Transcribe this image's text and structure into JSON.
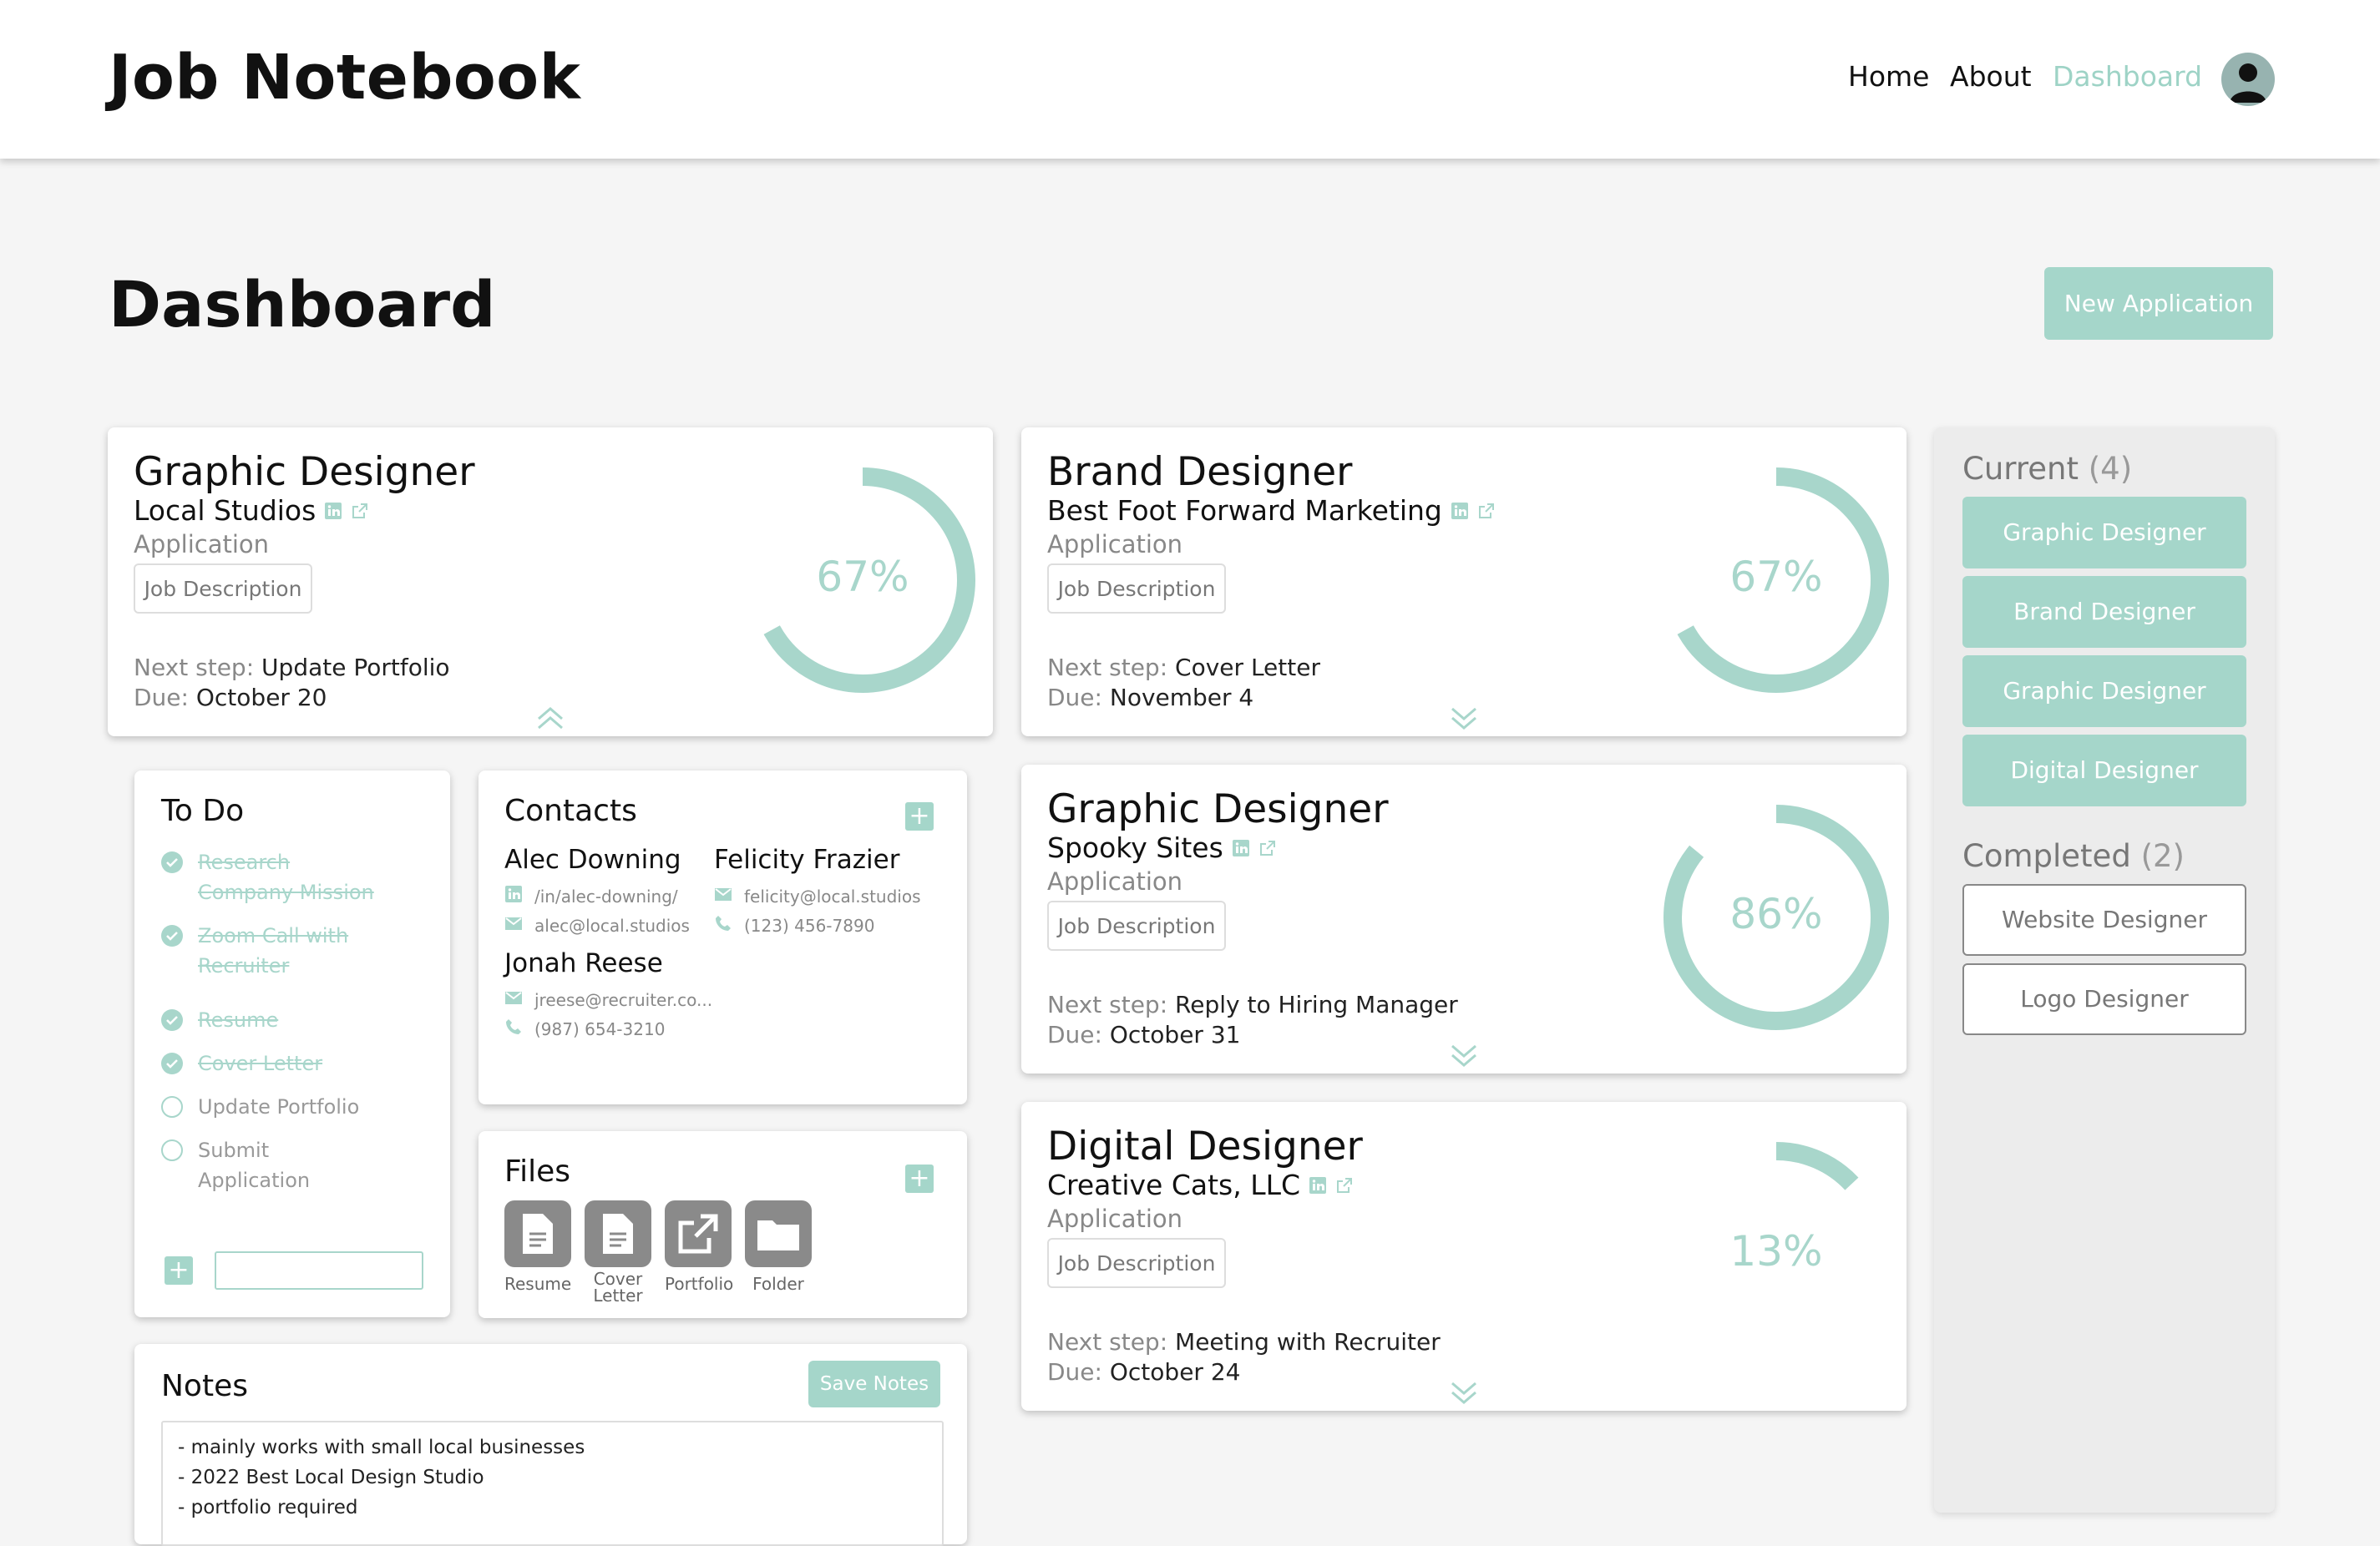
{
  "header": {
    "brand": "Job Notebook",
    "nav": {
      "home": "Home",
      "about": "About",
      "dashboard": "Dashboard"
    }
  },
  "page": {
    "title": "Dashboard",
    "new_application": "New Application"
  },
  "colors": {
    "accent": "#a5d6ca",
    "ring": "#a8d6cb"
  },
  "applications": [
    {
      "title": "Graphic Designer",
      "company": "Local Studios",
      "stage": "Application",
      "jd": "Job Description",
      "next_label": "Next step:",
      "next": "Update Portfolio",
      "due_label": "Due:",
      "due": "October 20",
      "progress_label": "67%",
      "progress": 0.67,
      "expanded": true
    },
    {
      "title": "Brand Designer",
      "company": "Best Foot Forward Marketing",
      "stage": "Application",
      "jd": "Job Description",
      "next_label": "Next step:",
      "next": "Cover Letter",
      "due_label": "Due:",
      "due": "November 4",
      "progress_label": "67%",
      "progress": 0.67,
      "expanded": false
    },
    {
      "title": "Graphic Designer",
      "company": "Spooky Sites",
      "stage": "Application",
      "jd": "Job Description",
      "next_label": "Next step:",
      "next": "Reply to Hiring Manager",
      "due_label": "Due:",
      "due": "October 31",
      "progress_label": "86%",
      "progress": 0.86,
      "expanded": false
    },
    {
      "title": "Digital Designer",
      "company": "Creative Cats, LLC",
      "stage": "Application",
      "jd": "Job Description",
      "next_label": "Next step:",
      "next": "Meeting with Recruiter",
      "due_label": "Due:",
      "due": "October 24",
      "progress_label": "13%",
      "progress": 0.13,
      "expanded": false
    }
  ],
  "todo": {
    "title": "To Do",
    "items": [
      {
        "text": "Research Company Mission",
        "done": true
      },
      {
        "text": "Zoom Call with Recruiter",
        "done": true
      },
      {
        "text": "Resume",
        "done": true
      },
      {
        "text": "Cover Letter",
        "done": true
      },
      {
        "text": "Update Portfolio",
        "done": false
      },
      {
        "text": "Submit Application",
        "done": false
      }
    ],
    "add_value": ""
  },
  "contacts": {
    "title": "Contacts",
    "people": [
      {
        "name": "Alec Downing",
        "lines": [
          {
            "icon": "linkedin-icon",
            "text": "/in/alec-downing/"
          },
          {
            "icon": "mail-icon",
            "text": "alec@local.studios"
          }
        ]
      },
      {
        "name": "Felicity Frazier",
        "lines": [
          {
            "icon": "mail-icon",
            "text": "felicity@local.studios"
          },
          {
            "icon": "phone-icon",
            "text": "(123) 456-7890"
          }
        ]
      },
      {
        "name": "Jonah Reese",
        "lines": [
          {
            "icon": "mail-icon",
            "text": "jreese@recruiter.co..."
          },
          {
            "icon": "phone-icon",
            "text": "(987) 654-3210"
          }
        ]
      }
    ]
  },
  "files": {
    "title": "Files",
    "items": [
      {
        "label": "Resume",
        "icon": "document-icon"
      },
      {
        "label": "Cover Letter",
        "icon": "document-icon"
      },
      {
        "label": "Portfolio",
        "icon": "external-link-icon"
      },
      {
        "label": "Folder",
        "icon": "folder-icon"
      }
    ]
  },
  "notes": {
    "title": "Notes",
    "save": "Save Notes",
    "lines": [
      "- mainly works with small local businesses",
      "- 2022 Best Local Design Studio",
      "- portfolio required"
    ]
  },
  "sidebar": {
    "current_label": "Current",
    "current_count": "(4)",
    "current": [
      "Graphic Designer",
      "Brand Designer",
      "Graphic Designer",
      "Digital Designer"
    ],
    "completed_label": "Completed",
    "completed_count": "(2)",
    "completed": [
      "Website Designer",
      "Logo Designer"
    ]
  }
}
